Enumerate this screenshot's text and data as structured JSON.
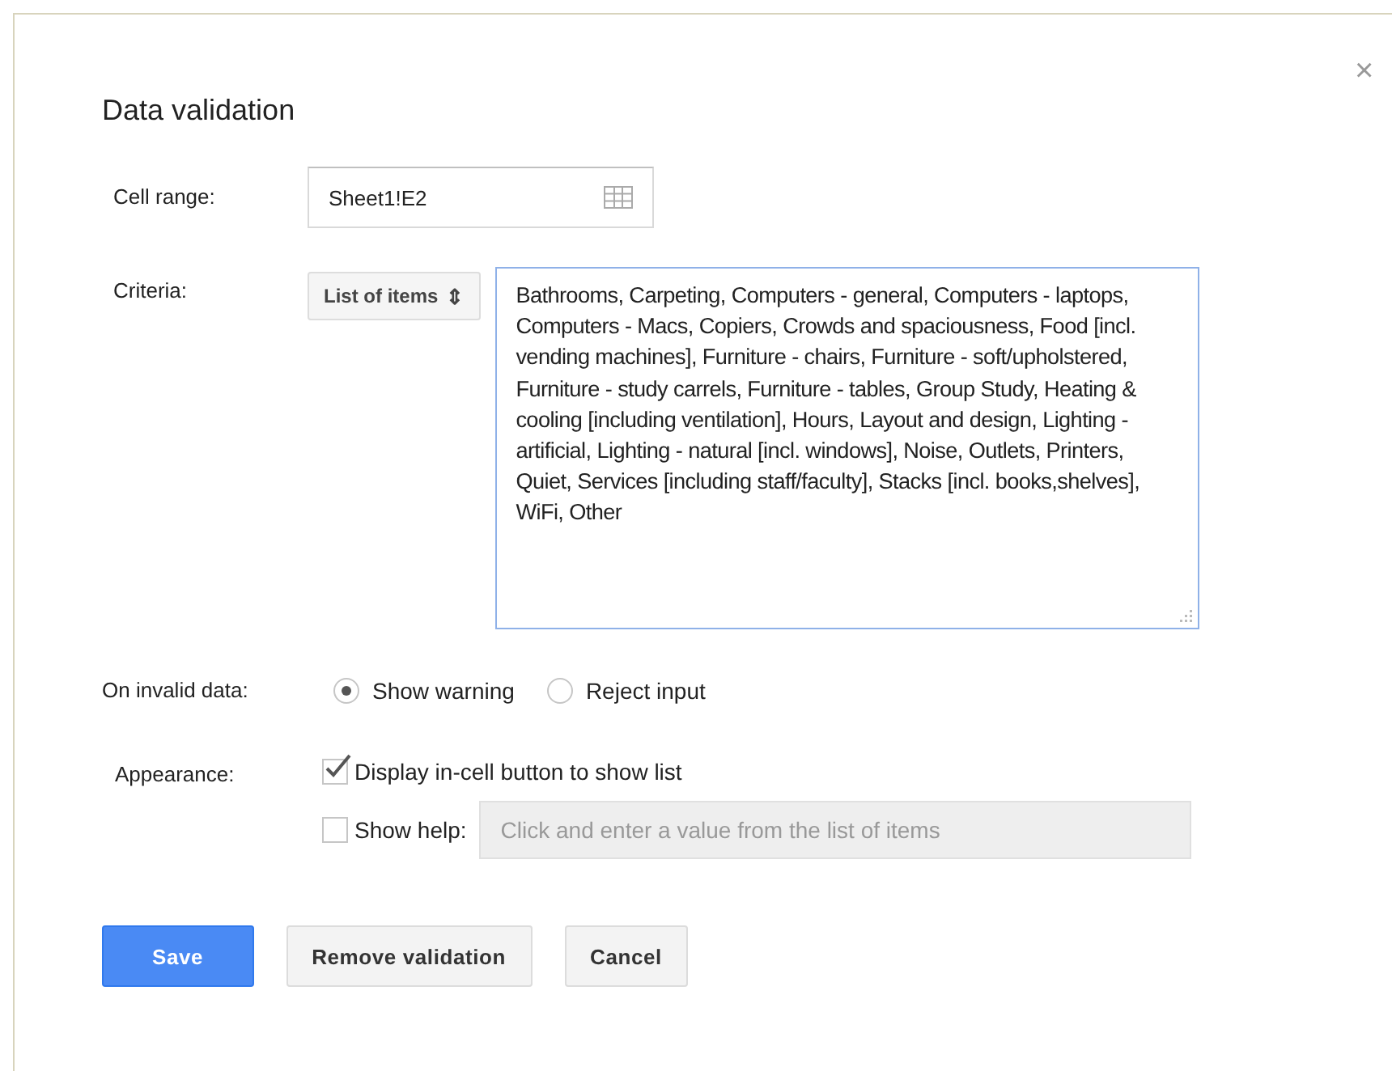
{
  "dialog": {
    "title": "Data validation",
    "close": "×"
  },
  "cell_range": {
    "label": "Cell range:",
    "value": "Sheet1!E2"
  },
  "criteria": {
    "label": "Criteria:",
    "type": "List of items",
    "arrows": "⇕",
    "items": "Bathrooms, Carpeting, Computers - general, Computers - laptops, Computers - Macs, Copiers, Crowds and spaciousness, Food [incl. vending machines], Furniture - chairs, Furniture - soft/upholstered, Furniture - study carrels, Furniture - tables, Group Study, Heating & cooling [including ventilation], Hours, Layout and design, Lighting - artificial, Lighting - natural [incl. windows], Noise, Outlets, Printers, Quiet, Services [including staff/faculty], Stacks [incl. books,shelves], WiFi, Other"
  },
  "on_invalid": {
    "label": "On invalid data:",
    "options": [
      {
        "label": "Show warning",
        "selected": true
      },
      {
        "label": "Reject input",
        "selected": false
      }
    ]
  },
  "appearance": {
    "label": "Appearance:",
    "options": [
      {
        "label": "Display in-cell button to show list",
        "checked": true
      },
      {
        "label": "Show help:",
        "checked": false,
        "placeholder": "Click and enter a value from the list of items"
      }
    ]
  },
  "buttons": [
    {
      "label": "Save",
      "kind": "primary"
    },
    {
      "label": "Remove validation",
      "kind": "normal"
    },
    {
      "label": "Cancel",
      "kind": "normal"
    }
  ]
}
